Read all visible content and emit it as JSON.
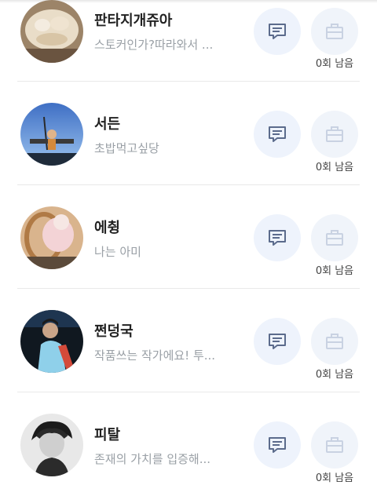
{
  "friends": [
    {
      "name": "판타지개쥬아",
      "status": "스토커인가?따라와서 ...",
      "remain": "0회 남음"
    },
    {
      "name": "서든",
      "status": "초밥먹고싶당",
      "remain": "0회 남음"
    },
    {
      "name": "에췽",
      "status": "나는 아미",
      "remain": "0회 남음"
    },
    {
      "name": "쩐덩국",
      "status": "작품쓰는 작가에요! 투...",
      "remain": "0회 남음"
    },
    {
      "name": "피탈",
      "status": "존재의 가치를 입증해...",
      "remain": "0회 남음"
    }
  ],
  "colors": {
    "chat_icon": "#5b6b8c",
    "gift_icon": "#c9d2e2",
    "chat_bg": "#eef3fc",
    "gift_bg": "#f0f4fa"
  },
  "icons": {
    "chat": "message-square-icon",
    "gift": "briefcase-icon"
  }
}
